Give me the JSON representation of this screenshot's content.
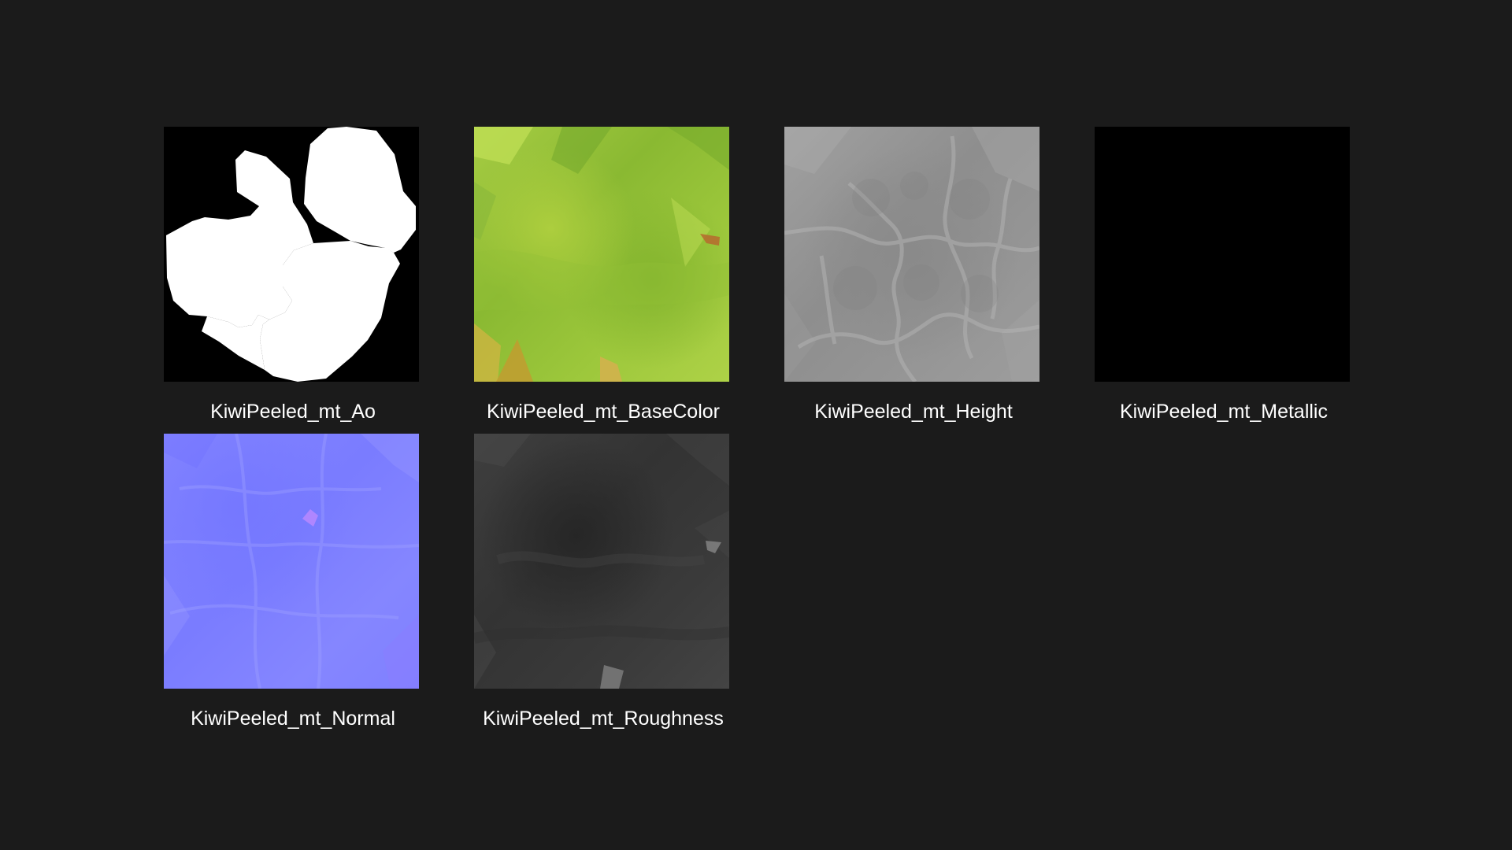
{
  "files": [
    {
      "id": "ao",
      "name": "KiwiPeeled_mt_Ao"
    },
    {
      "id": "basecolor",
      "name": "KiwiPeeled_mt_BaseColor"
    },
    {
      "id": "height",
      "name": "KiwiPeeled_mt_Height"
    },
    {
      "id": "metallic",
      "name": "KiwiPeeled_mt_Metallic"
    },
    {
      "id": "normal",
      "name": "KiwiPeeled_mt_Normal"
    },
    {
      "id": "roughness",
      "name": "KiwiPeeled_mt_Roughness"
    }
  ],
  "colors": {
    "background": "#1b1b1b",
    "label": "#ffffff",
    "ao_black": "#000000",
    "ao_white": "#ffffff",
    "basecolor_green": "#9cc73b",
    "height_gray": "#959595",
    "metallic_black": "#000000",
    "normal_blue": "#7f80ff",
    "roughness_gray": "#3a3a3a"
  }
}
